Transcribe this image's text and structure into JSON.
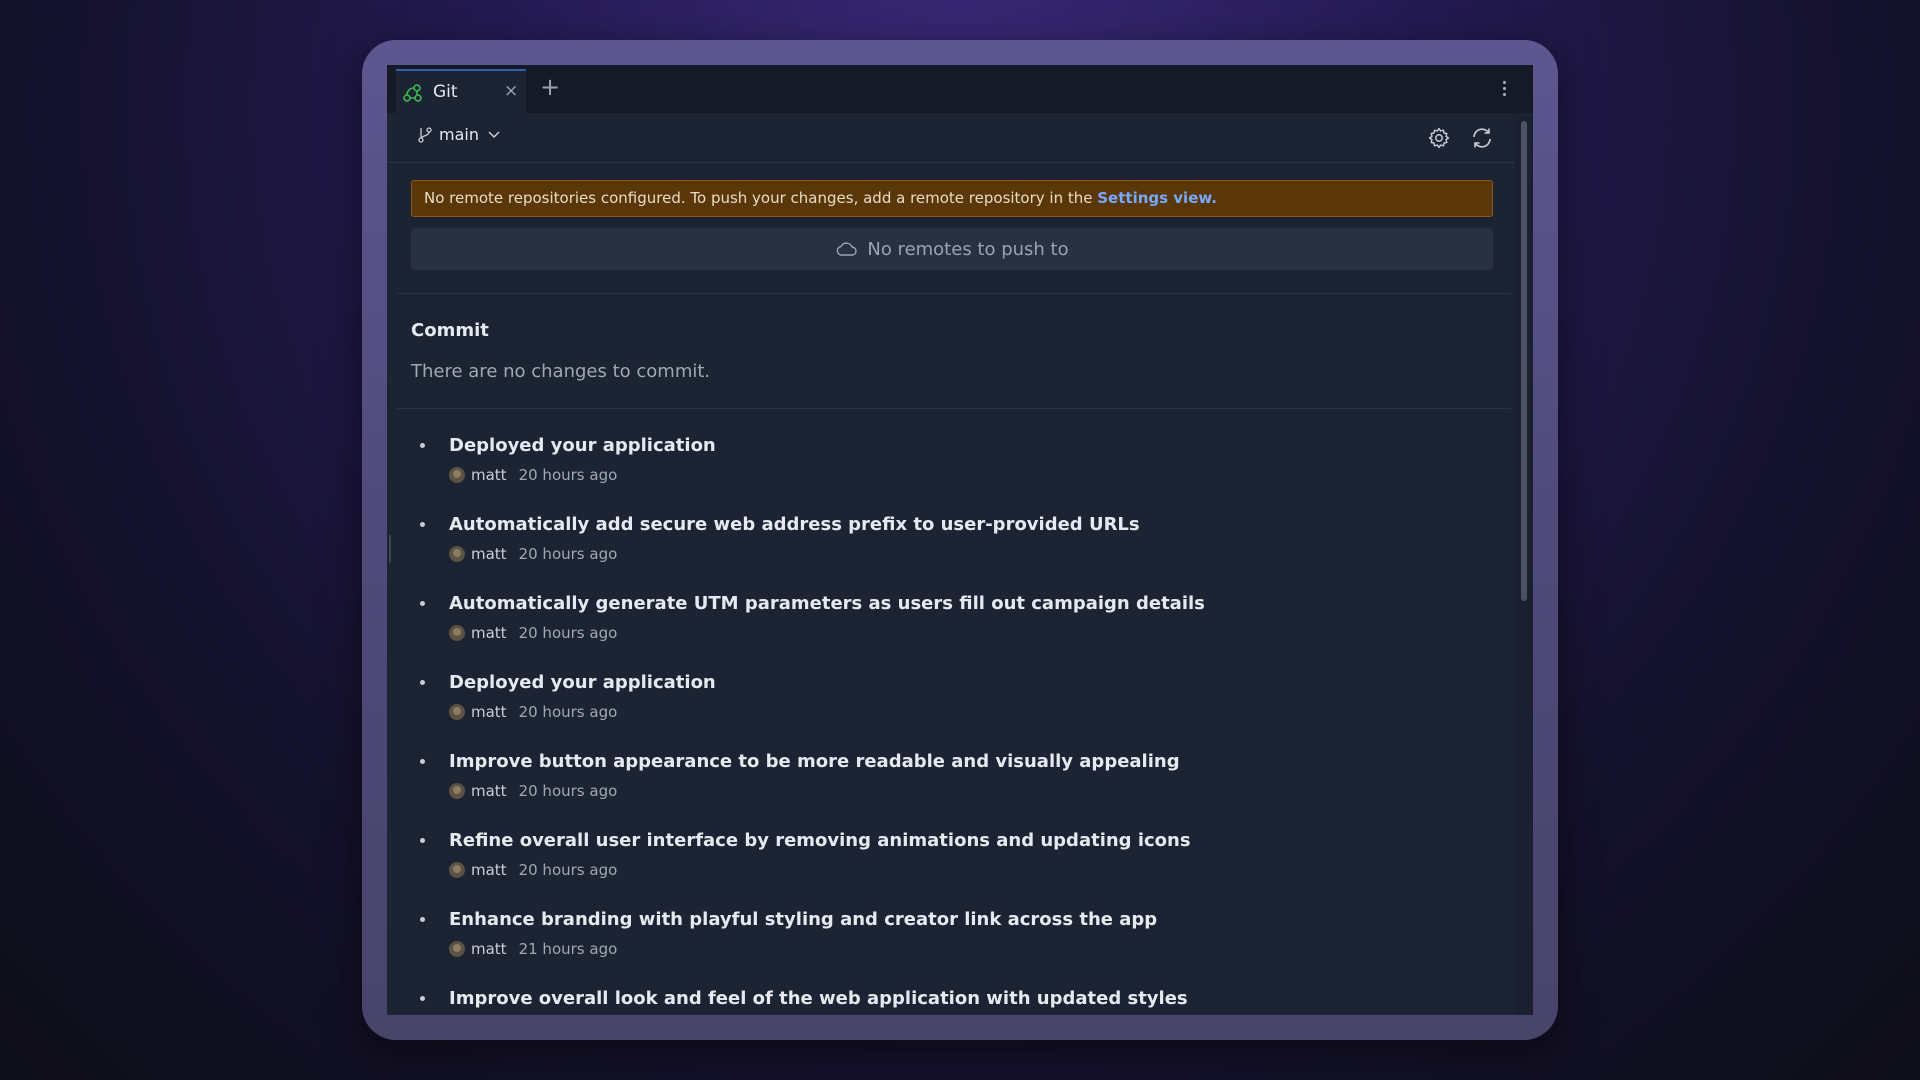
{
  "tab": {
    "label": "Git",
    "close": "×",
    "add": "+"
  },
  "toolbar": {
    "branch": "main"
  },
  "banner": {
    "text": "No remote repositories configured. To push your changes, add a remote repository in the ",
    "link": "Settings view."
  },
  "push_button": {
    "label": "No remotes to push to"
  },
  "commit": {
    "title": "Commit",
    "empty_text": "There are no changes to commit."
  },
  "history": [
    {
      "message": "Deployed your application",
      "author": "matt",
      "time": "20 hours ago"
    },
    {
      "message": "Automatically add secure web address prefix to user-provided URLs",
      "author": "matt",
      "time": "20 hours ago"
    },
    {
      "message": "Automatically generate UTM parameters as users fill out campaign details",
      "author": "matt",
      "time": "20 hours ago"
    },
    {
      "message": "Deployed your application",
      "author": "matt",
      "time": "20 hours ago"
    },
    {
      "message": "Improve button appearance to be more readable and visually appealing",
      "author": "matt",
      "time": "20 hours ago"
    },
    {
      "message": "Refine overall user interface by removing animations and updating icons",
      "author": "matt",
      "time": "20 hours ago"
    },
    {
      "message": "Enhance branding with playful styling and creator link across the app",
      "author": "matt",
      "time": "21 hours ago"
    },
    {
      "message": "Improve overall look and feel of the web application with updated styles",
      "author": "",
      "time": ""
    }
  ],
  "colors": {
    "accent": "#2f5fb0",
    "git_icon": "#3fb950",
    "warning_bg": "#5a3708",
    "link": "#78a9ff"
  },
  "icons": [
    "git-icon",
    "close-icon",
    "plus-icon",
    "kebab-menu-icon",
    "branch-icon",
    "chevron-down-icon",
    "gear-icon",
    "refresh-icon",
    "cloud-icon",
    "avatar"
  ]
}
